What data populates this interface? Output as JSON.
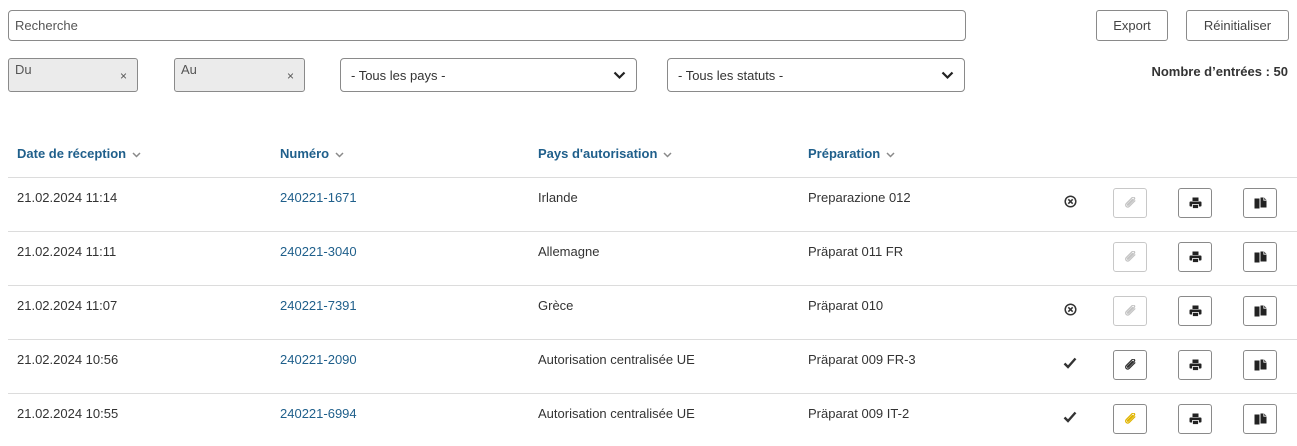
{
  "search": {
    "placeholder": "Recherche"
  },
  "toolbar": {
    "export_label": "Export",
    "reset_label": "Réinitialiser"
  },
  "filters": {
    "date_from_placeholder": "Du",
    "date_to_placeholder": "Au",
    "clear_symbol": "×",
    "country_selected": "- Tous les pays -",
    "status_selected": "- Tous les statuts -"
  },
  "entries_count_label": "Nombre d’entrées : 50",
  "table": {
    "columns": [
      "Date de réception",
      "Numéro",
      "Pays d'autorisation",
      "Préparation"
    ],
    "rows": [
      {
        "date": "21.02.2024 11:14",
        "number": "240221-1671",
        "country": "Irlande",
        "preparation": "Preparazione 012",
        "status": "cancelled-icon",
        "attachment": "disabled"
      },
      {
        "date": "21.02.2024 11:11",
        "number": "240221-3040",
        "country": "Allemagne",
        "preparation": "Präparat 011 FR",
        "status": "none",
        "attachment": "disabled"
      },
      {
        "date": "21.02.2024 11:07",
        "number": "240221-7391",
        "country": "Grèce",
        "preparation": "Präparat 010",
        "status": "cancelled-icon",
        "attachment": "disabled"
      },
      {
        "date": "21.02.2024 10:56",
        "number": "240221-2090",
        "country": "Autorisation centralisée UE",
        "preparation": "Präparat 009 FR-3",
        "status": "checkmark-icon",
        "attachment": "enabled"
      },
      {
        "date": "21.02.2024 10:55",
        "number": "240221-6994",
        "country": "Autorisation centralisée UE",
        "preparation": "Präparat 009 IT-2",
        "status": "checkmark-icon",
        "attachment": "highlighted"
      }
    ]
  },
  "colors": {
    "link": "#1f5f8b",
    "attachment_disabled": "#c4c4c4",
    "attachment_enabled": "#333333",
    "attachment_highlighted": "#e0b400"
  }
}
